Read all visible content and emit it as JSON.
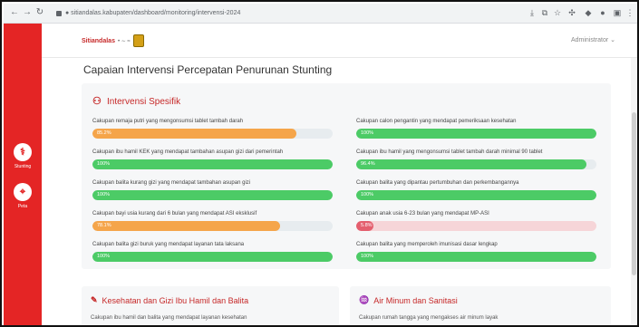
{
  "browser": {
    "url": "● sitiandalas.kabupaten/dashboard/monitoring/intervensi-2024",
    "icons": [
      "back-icon",
      "forward-icon",
      "reload-icon",
      "download-icon",
      "bookmark-icon",
      "star-icon",
      "extensions-icon",
      "profile-icon",
      "menu-icon"
    ]
  },
  "header": {
    "logo_text": "Sitiandalas",
    "logo_sep": "• ∼ ≈",
    "user": "Administrator ⌄"
  },
  "sidebar": {
    "items": [
      {
        "label": "Stunting",
        "glyph": "⚕",
        "icon": "health-icon"
      },
      {
        "label": "Peta",
        "glyph": "⌖",
        "icon": "map-pin-icon"
      }
    ]
  },
  "page": {
    "title": "Capaian Intervensi Percepatan Penurunan Stunting"
  },
  "panel": {
    "title": "Intervensi Spesifik",
    "metrics": [
      {
        "label": "Cakupan remaja putri yang mengonsumsi tablet tambah darah",
        "value_text": "85.2%",
        "value": 0.85,
        "color": "#f5a54a"
      },
      {
        "label": "Cakupan calon pengantin yang mendapat pemeriksaan kesehatan",
        "value_text": "100%",
        "value": 1.0,
        "color": "#4ccb66"
      },
      {
        "label": "Cakupan ibu hamil KEK yang mendapat tambahan asupan gizi dari pemerintah",
        "value_text": "100%",
        "value": 1.0,
        "color": "#4ccb66"
      },
      {
        "label": "Cakupan ibu hamil yang mengonsumsi tablet tambah darah minimal 90 tablet",
        "value_text": "96.4%",
        "value": 0.96,
        "color": "#4ccb66"
      },
      {
        "label": "Cakupan balita kurang gizi yang mendapat tambahan asupan gizi",
        "value_text": "100%",
        "value": 1.0,
        "color": "#4ccb66"
      },
      {
        "label": "Cakupan balita yang dipantau pertumbuhan dan perkembangannya",
        "value_text": "100%",
        "value": 1.0,
        "color": "#4ccb66"
      },
      {
        "label": "Cakupan bayi usia kurang dari 6 bulan yang mendapat ASI eksklusif",
        "value_text": "78.1%",
        "value": 0.78,
        "color": "#f5a54a"
      },
      {
        "label": "Cakupan anak usia 6-23 bulan yang mendapat MP-ASI",
        "value_text": "5.8%",
        "value": 0.06,
        "color": "#e45f6e",
        "track": "#f6d5d8"
      },
      {
        "label": "Cakupan balita gizi buruk yang mendapat layanan tata laksana",
        "value_text": "100%",
        "value": 1.0,
        "color": "#4ccb66"
      },
      {
        "label": "Cakupan balita yang memperoleh imunisasi dasar lengkap",
        "value_text": "100%",
        "value": 1.0,
        "color": "#4ccb66"
      }
    ]
  },
  "cards": [
    {
      "title": "Kesehatan dan Gizi Ibu Hamil dan Balita",
      "icon": "✎",
      "sub": "Cakupan ibu hamil dan balita yang mendapat layanan kesehatan"
    },
    {
      "title": "Air Minum dan Sanitasi",
      "icon": "♒",
      "sub": "Cakupan rumah tangga yang mengakses air minum layak"
    }
  ]
}
